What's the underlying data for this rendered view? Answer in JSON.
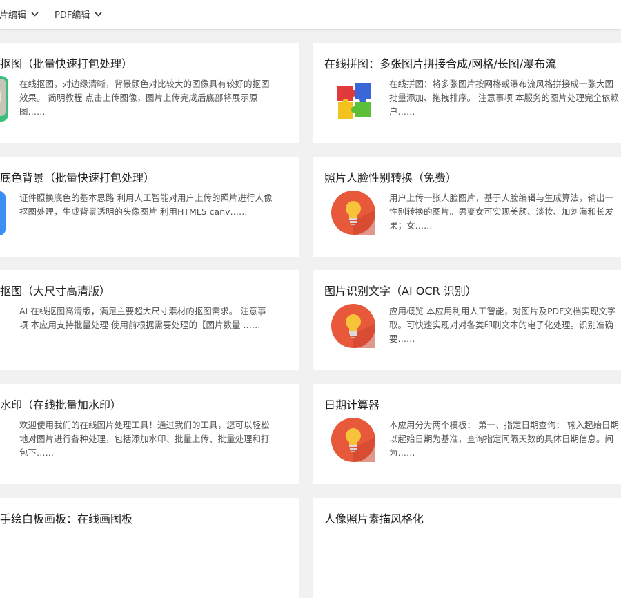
{
  "nav": {
    "items": [
      {
        "label": "图片编辑"
      },
      {
        "label": "PDF编辑"
      }
    ]
  },
  "cards_left": [
    {
      "title": "抠图（批量快速打包处理）",
      "desc": [
        "在线抠图，对边缘清晰，背景颜色对比较大的图像具有较好的抠图",
        "效果。 简明教程 点击上传图像，图片上传完成后底部将展示原",
        "图……"
      ],
      "icon": "image-thumbnail-icon"
    },
    {
      "title": "底色背景（批量快速打包处理）",
      "desc": [
        "证件照换底色的基本思路 利用人工智能对用户上传的照片进行人像",
        "抠图处理，生成背景透明的头像图片 利用HTML5 canv……"
      ],
      "icon": "blue-app-icon"
    },
    {
      "title": "抠图（大尺寸高清版）",
      "desc": [
        "AI 在线抠图高清版，满足主要超大尺寸素材的抠图需求。 注意事",
        "项 本应用支持批量处理 使用前根据需要处理的【图片数量 ……"
      ],
      "icon": ""
    },
    {
      "title": "水印（在线批量加水印）",
      "desc": [
        "欢迎使用我们的在线图片处理工具！通过我们的工具，您可以轻松",
        "地对图片进行各种处理，包括添加水印、批量上传、批量处理和打",
        "包下……"
      ],
      "icon": "lightbulb-icon"
    },
    {
      "title": "手绘白板画板：在线画图板",
      "desc": [],
      "icon": ""
    }
  ],
  "cards_right": [
    {
      "title": "在线拼图：多张图片拼接合成/网格/长图/瀑布流",
      "desc": [
        "在线拼图：将多张图片按网格或瀑布流风格拼接成一张大图",
        "批量添加、拖拽排序。 注意事项 本服务的图片处理完全依赖",
        "户……"
      ],
      "icon": "puzzle-icon"
    },
    {
      "title": "照片人脸性别转换（免费）",
      "desc": [
        "用户上传一张人脸图片，基于人脸编辑与生成算法，输出一",
        "性别转换的图片。男变女可实现美颜、淡妆、加刘海和长发",
        "果；女……"
      ],
      "icon": "lightbulb-icon"
    },
    {
      "title": "图片识别文字（AI OCR 识别）",
      "desc": [
        "应用概览 本应用利用人工智能，对图片及PDF文档实现文字",
        "取。可快速实现对对各类印刷文本的电子化处理。识别准确",
        "要……"
      ],
      "icon": "lightbulb-icon"
    },
    {
      "title": "日期计算器",
      "desc": [
        "本应用分为两个模板： 第一、指定日期查询： 输入起始日期",
        "以起始日期为基准，查询指定间隔天数的具体日期信息。间",
        "为……"
      ],
      "icon": "lightbulb-icon"
    },
    {
      "title": "人像照片素描风格化",
      "desc": [],
      "icon": ""
    }
  ]
}
